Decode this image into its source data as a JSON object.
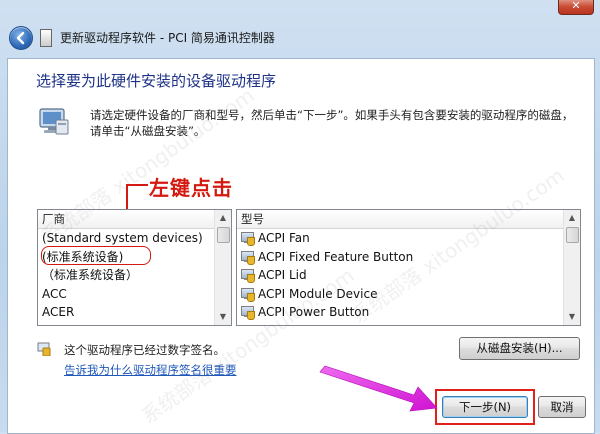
{
  "window": {
    "title": "更新驱动程序软件 - PCI 简易通讯控制器",
    "close_label": "✕"
  },
  "header": {
    "heading": "选择要为此硬件安装的设备驱动程序",
    "instruction": "请选定硬件设备的厂商和型号，然后单击“下一步”。如果手头有包含要安装的驱动程序的磁盘，请单击“从磁盘安装”。"
  },
  "annotation": {
    "text": "左键点击",
    "color": "#d41a10"
  },
  "manufacturer_list": {
    "header": "厂商",
    "items": [
      "(Standard system devices)",
      "(标准系统设备)",
      "（标准系统设备）",
      "ACC",
      "ACER"
    ],
    "circled_index": 1
  },
  "model_list": {
    "header": "型号",
    "items": [
      "ACPI Fan",
      "ACPI Fixed Feature Button",
      "ACPI Lid",
      "ACPI Module Device",
      "ACPI Power Button"
    ]
  },
  "signature": {
    "status": "这个驱动程序已经过数字签名。",
    "link": "告诉我为什么驱动程序签名很重要"
  },
  "buttons": {
    "have_disk": "从磁盘安装(H)...",
    "next": "下一步(N)",
    "cancel": "取消"
  },
  "watermark": "系统部落 xitongbuluo.com",
  "colors": {
    "heading": "#1e3287",
    "link": "#1f58b9",
    "highlight_red": "#e0201a",
    "arrow_magenta": "#e21be0"
  }
}
